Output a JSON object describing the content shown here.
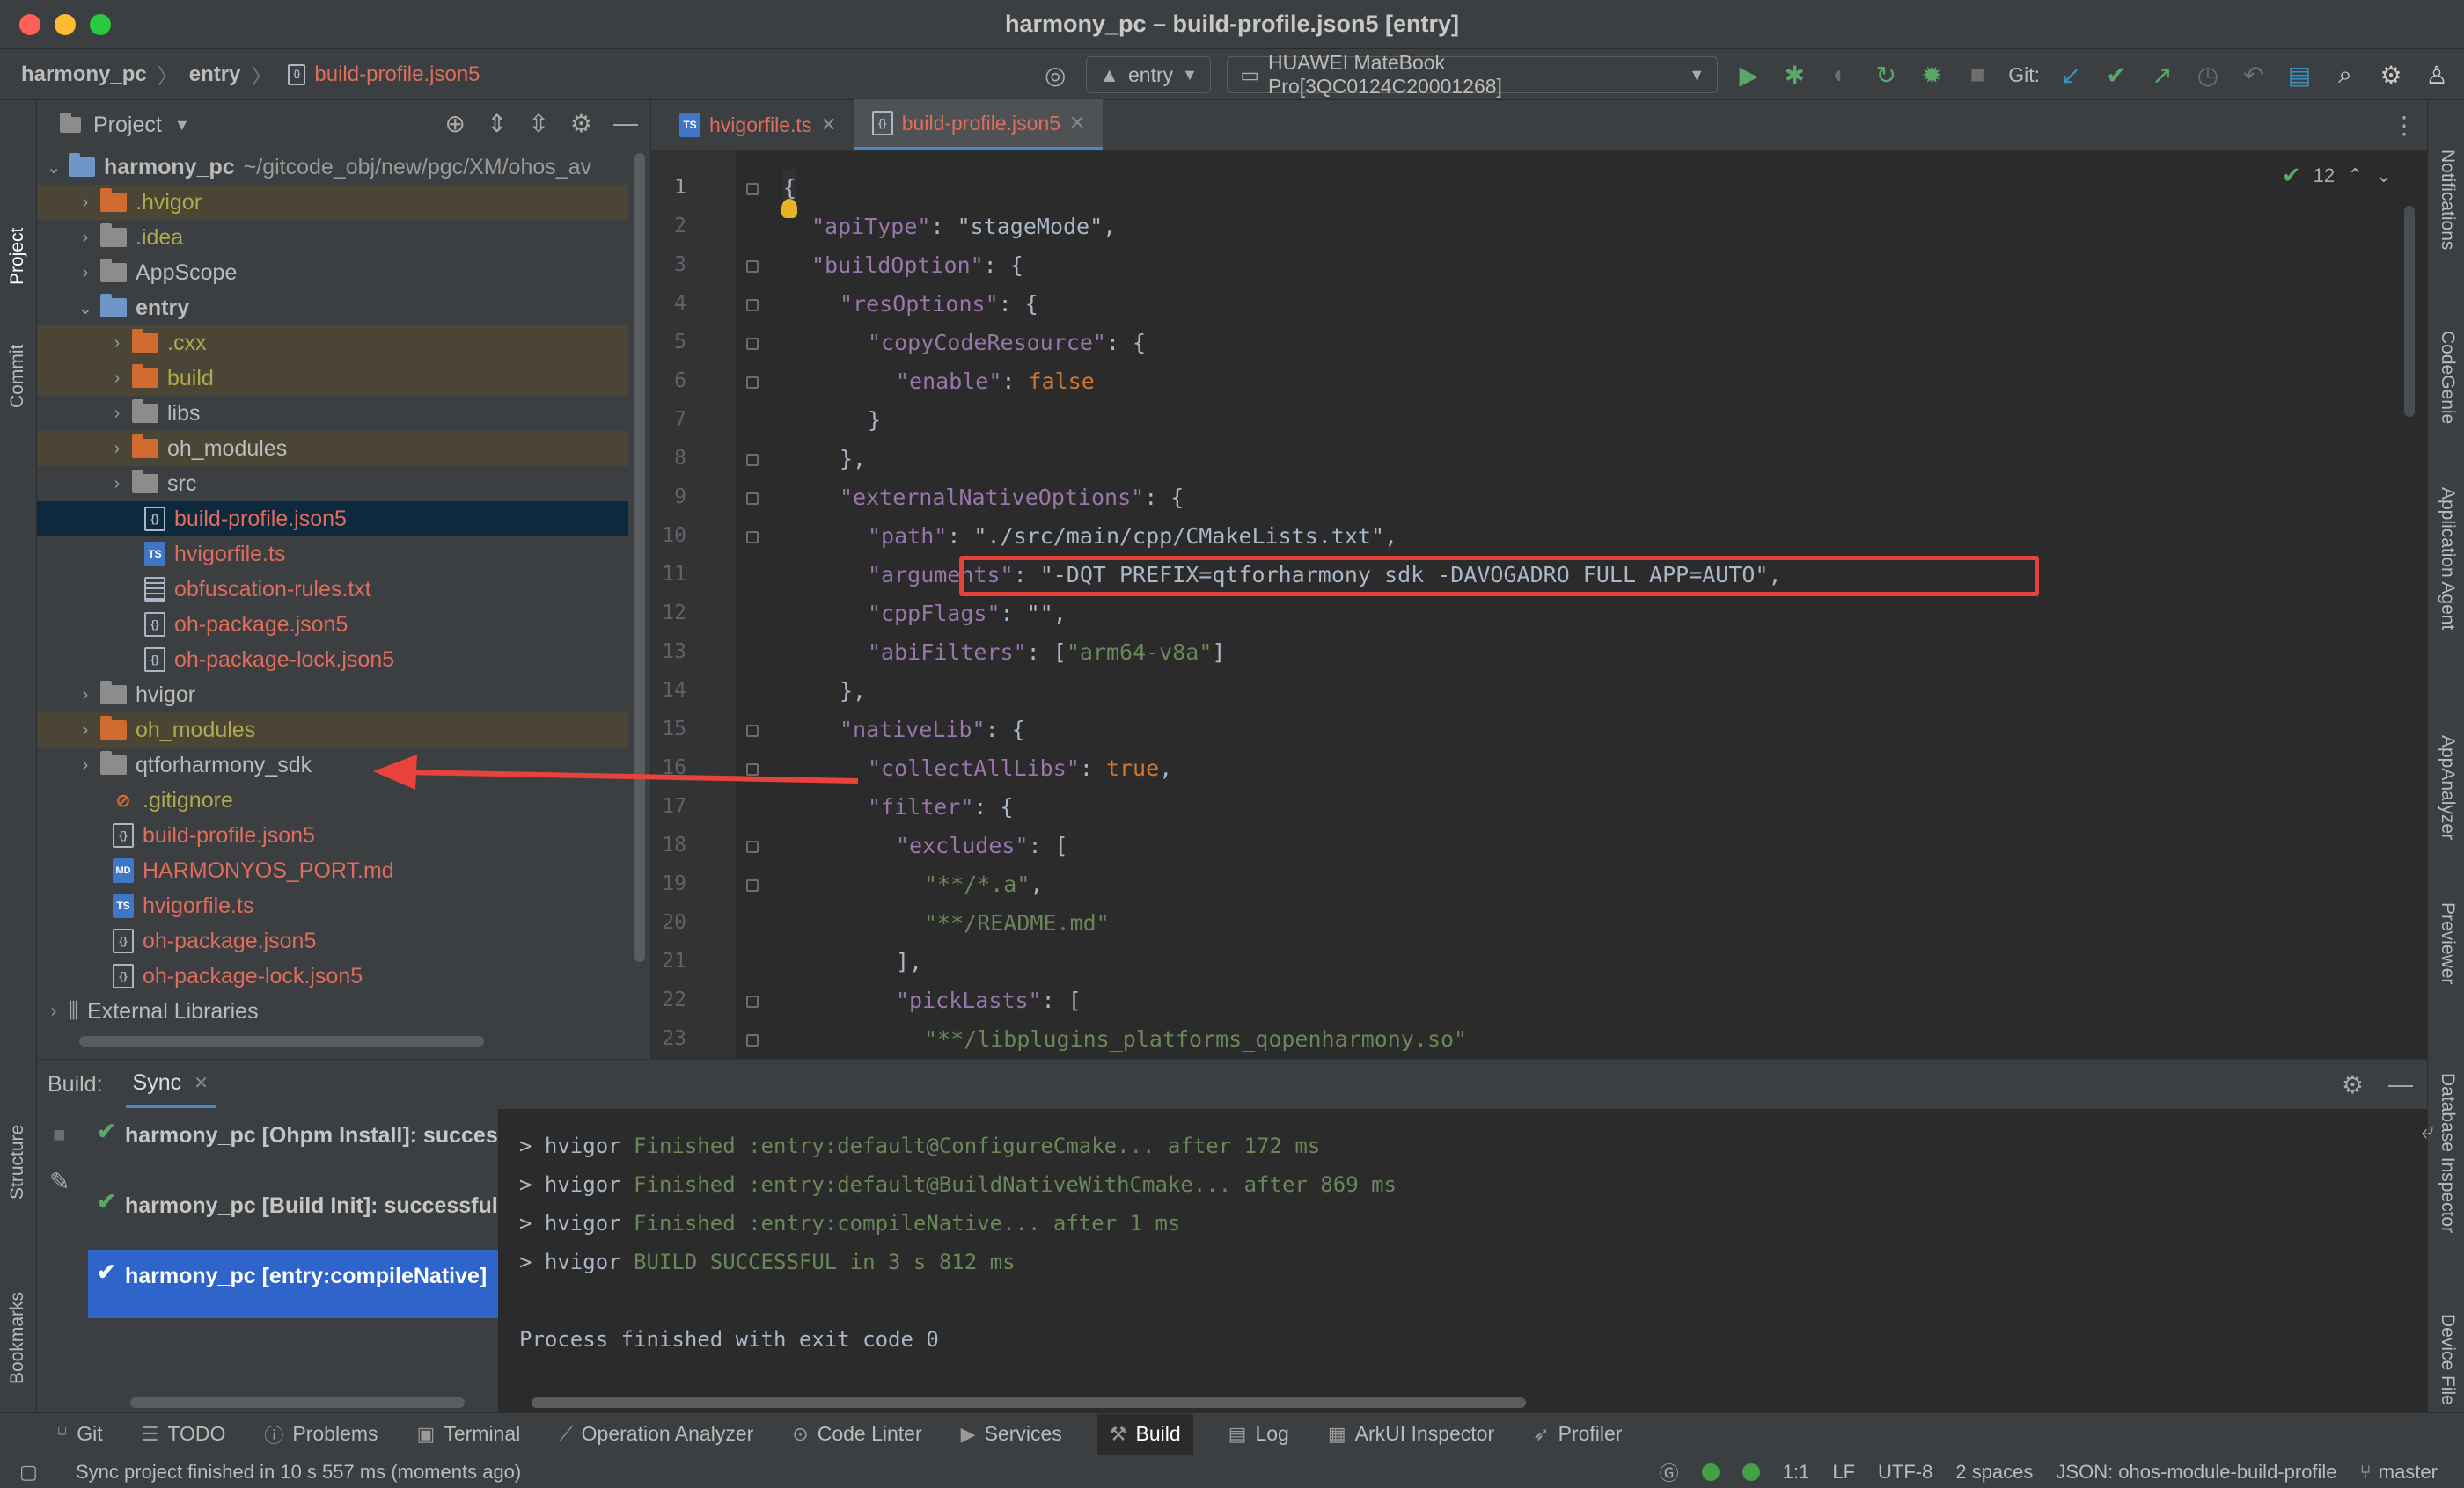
{
  "window": {
    "title": "harmony_pc – build-profile.json5 [entry]"
  },
  "breadcrumb": {
    "project": "harmony_pc",
    "module": "entry",
    "file": "build-profile.json5"
  },
  "toolbar": {
    "module_select": "entry",
    "device_select": "HUAWEI MateBook Pro[3QC0124C20001268]",
    "git_label": "Git:",
    "icons": [
      "target-icon",
      "run-icon",
      "debug-icon",
      "attach-icon",
      "refresh-icon",
      "profile-icon",
      "stop-icon",
      "git-update-icon",
      "git-commit-icon",
      "git-push-icon",
      "history-icon",
      "rollback-icon",
      "project-structure-icon",
      "search-icon",
      "settings-icon",
      "account-icon"
    ]
  },
  "left_strip": {
    "project": "Project",
    "commit": "Commit",
    "structure": "Structure",
    "bookmarks": "Bookmarks"
  },
  "right_strip": {
    "notifications": "Notifications",
    "codegenie": "CodeGenie",
    "app_agent": "Application Agent",
    "appanalyzer": "AppAnalyzer",
    "previewer": "Previewer",
    "database": "Database Inspector",
    "device_file": "Device File"
  },
  "project_panel": {
    "title": "Project",
    "tree": [
      {
        "label": "harmony_pc",
        "suffix": "~/gitcode_obj/new/pgc/XM/ohos_av"
      },
      {
        "label": ".hvigor"
      },
      {
        "label": ".idea"
      },
      {
        "label": "AppScope"
      },
      {
        "label": "entry"
      },
      {
        "label": ".cxx"
      },
      {
        "label": "build"
      },
      {
        "label": "libs"
      },
      {
        "label": "oh_modules"
      },
      {
        "label": "src"
      },
      {
        "label": "build-profile.json5"
      },
      {
        "label": "hvigorfile.ts"
      },
      {
        "label": "obfuscation-rules.txt"
      },
      {
        "label": "oh-package.json5"
      },
      {
        "label": "oh-package-lock.json5"
      },
      {
        "label": "hvigor"
      },
      {
        "label": "oh_modules"
      },
      {
        "label": "qtforharmony_sdk"
      },
      {
        "label": ".gitignore"
      },
      {
        "label": "build-profile.json5"
      },
      {
        "label": "HARMONYOS_PORT.md"
      },
      {
        "label": "hvigorfile.ts"
      },
      {
        "label": "oh-package.json5"
      },
      {
        "label": "oh-package-lock.json5"
      },
      {
        "label": "External Libraries"
      }
    ]
  },
  "editor": {
    "tabs": [
      {
        "label": "hvigorfile.ts",
        "icon": "TS"
      },
      {
        "label": "build-profile.json5",
        "icon": "{}"
      }
    ],
    "inspection_count": "12",
    "lines": [
      {
        "n": "1",
        "t": "{"
      },
      {
        "n": "2",
        "t": "\"apiType\": \"stageMode\","
      },
      {
        "n": "3",
        "t": "\"buildOption\": {"
      },
      {
        "n": "4",
        "t": "\"resOptions\": {"
      },
      {
        "n": "5",
        "t": "\"copyCodeResource\": {"
      },
      {
        "n": "6",
        "t": "\"enable\": false"
      },
      {
        "n": "7",
        "t": "}"
      },
      {
        "n": "8",
        "t": "},"
      },
      {
        "n": "9",
        "t": "\"externalNativeOptions\": {"
      },
      {
        "n": "10",
        "t": "\"path\": \"./src/main/cpp/CMakeLists.txt\","
      },
      {
        "n": "11",
        "t": "\"arguments\": \"-DQT_PREFIX=qtforharmony_sdk -DAVOGADRO_FULL_APP=AUTO\","
      },
      {
        "n": "12",
        "t": "\"cppFlags\": \"\","
      },
      {
        "n": "13",
        "t": "\"abiFilters\": [\"arm64-v8a\"]"
      },
      {
        "n": "14",
        "t": "},"
      },
      {
        "n": "15",
        "t": "\"nativeLib\": {"
      },
      {
        "n": "16",
        "t": "\"collectAllLibs\": true,"
      },
      {
        "n": "17",
        "t": "\"filter\": {"
      },
      {
        "n": "18",
        "t": "\"excludes\": ["
      },
      {
        "n": "19",
        "t": "\"**/*.a\","
      },
      {
        "n": "20",
        "t": "\"**/README.md\""
      },
      {
        "n": "21",
        "t": "],"
      },
      {
        "n": "22",
        "t": "\"pickLasts\": ["
      },
      {
        "n": "23",
        "t": "\"**/libplugins_platforms_qopenharmony.so\""
      }
    ]
  },
  "build_panel": {
    "label": "Build:",
    "tab": "Sync",
    "items": [
      "harmony_pc [Ohpm Install]: successful",
      "harmony_pc [Build Init]: successful",
      "harmony_pc [entry:compileNative]"
    ],
    "console": [
      {
        "prefix": "> hvigor ",
        "msg": "Finished :entry:default@ConfigureCmake... after 172 ms"
      },
      {
        "prefix": "> hvigor ",
        "msg": "Finished :entry:default@BuildNativeWithCmake... after 869 ms"
      },
      {
        "prefix": "> hvigor ",
        "msg": "Finished :entry:compileNative... after 1 ms"
      },
      {
        "prefix": "> hvigor ",
        "msg": "BUILD SUCCESSFUL in 3 s 812 ms"
      },
      {
        "prefix": "",
        "msg": "Process finished with exit code 0"
      }
    ]
  },
  "tool_windows": [
    "Git",
    "TODO",
    "Problems",
    "Terminal",
    "Operation Analyzer",
    "Code Linter",
    "Services",
    "Build",
    "Log",
    "ArkUI Inspector",
    "Profiler"
  ],
  "status_bar": {
    "message": "Sync project finished in 10 s 557 ms (moments ago)",
    "position": "1:1",
    "line_sep": "LF",
    "encoding": "UTF-8",
    "indent": "2 spaces",
    "schema": "JSON: ohos-module-build-profile",
    "branch": "master"
  },
  "colors": {
    "accent": "#4a88c7",
    "annotation": "#e8423d",
    "success": "#59a869"
  }
}
